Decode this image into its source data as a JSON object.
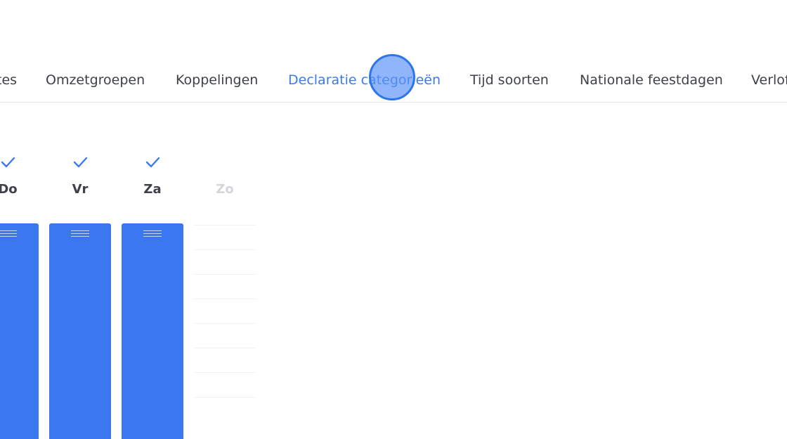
{
  "tabs": [
    {
      "label": "tes",
      "active": false
    },
    {
      "label": "Omzetgroepen",
      "active": false
    },
    {
      "label": "Koppelingen",
      "active": false
    },
    {
      "label": "Declaratie categorieën",
      "active": true
    },
    {
      "label": "Tijd soorten",
      "active": false
    },
    {
      "label": "Nationale feestdagen",
      "active": false
    },
    {
      "label": "Verlof",
      "active": false
    }
  ],
  "days": [
    {
      "label": "Do",
      "checked": true,
      "enabled": true
    },
    {
      "label": "Vr",
      "checked": true,
      "enabled": true
    },
    {
      "label": "Za",
      "checked": true,
      "enabled": true
    },
    {
      "label": "Zo",
      "checked": false,
      "enabled": false
    }
  ],
  "colors": {
    "accent": "#3a7bea",
    "bar": "#3b78ef",
    "text": "#3e4147",
    "disabled_text": "#d4d6da"
  }
}
